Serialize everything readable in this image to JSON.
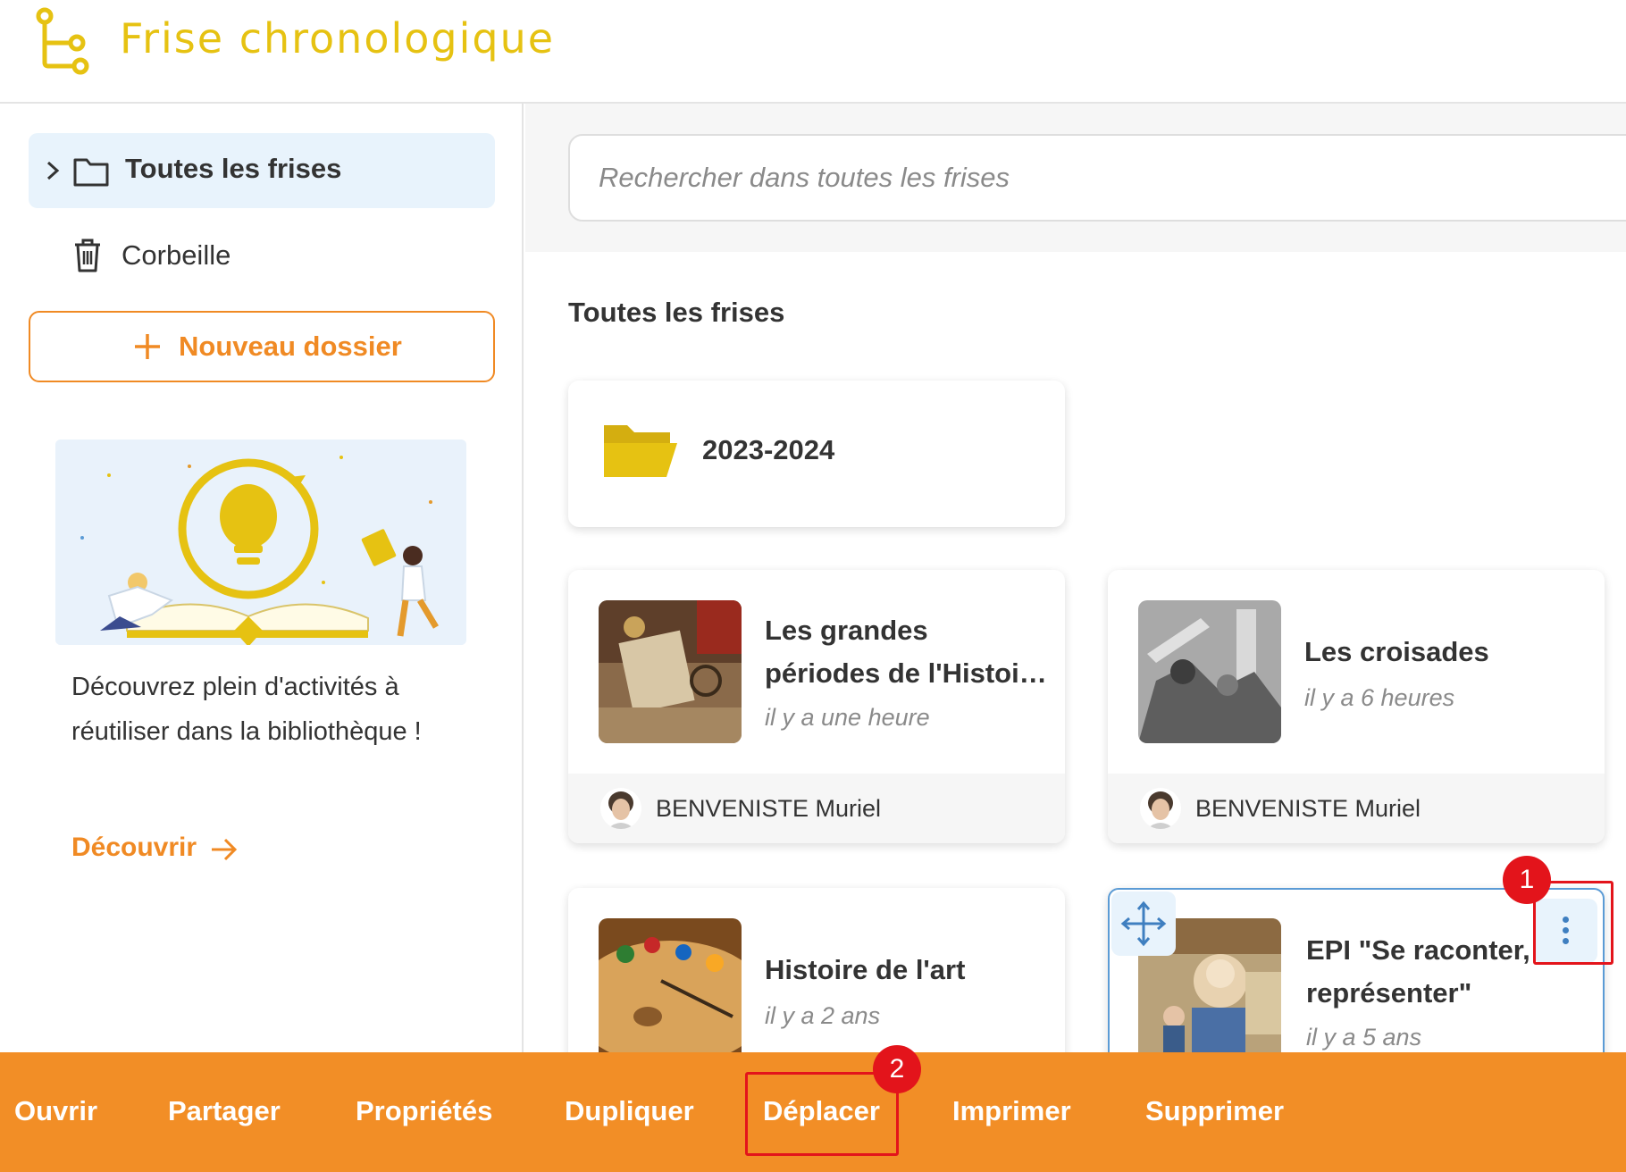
{
  "header": {
    "app_title": "Frise chronologique"
  },
  "sidebar": {
    "nav_all_label": "Toutes les frises",
    "nav_trash_label": "Corbeille",
    "new_folder_label": "Nouveau dossier",
    "promo_text": "Découvrez plein d'activités à réutiliser dans la bibliothèque !",
    "promo_link": "Découvrir"
  },
  "main": {
    "search_placeholder": "Rechercher dans toutes les frises",
    "section_title": "Toutes les frises",
    "folders": [
      {
        "name": "2023-2024"
      }
    ],
    "frises": [
      {
        "title": "Les grandes périodes de l'Histoi…",
        "date": "il y a une heure",
        "author": "BENVENISTE Muriel"
      },
      {
        "title": "Les croisades",
        "date": "il y a 6 heures",
        "author": "BENVENISTE Muriel"
      },
      {
        "title": "Histoire de l'art",
        "date": "il y a 2 ans"
      },
      {
        "title": "EPI \"Se raconter, se représenter\"",
        "date": "il y a 5 ans"
      }
    ]
  },
  "action_bar": {
    "actions": [
      "Ouvrir",
      "Partager",
      "Propriétés",
      "Dupliquer",
      "Déplacer",
      "Imprimer",
      "Supprimer"
    ]
  },
  "annotations": [
    {
      "label": "1"
    },
    {
      "label": "2"
    }
  ],
  "colors": {
    "brand_yellow": "#e6c212",
    "accent_orange": "#f08a24",
    "action_bar": "#f28e26",
    "selection_blue": "#5b9bd5",
    "highlight_red": "#e3141b"
  },
  "icons": [
    "logo-icon",
    "chevron-right-icon",
    "folder-outline-icon",
    "trash-icon",
    "plus-icon",
    "arrow-right-icon",
    "folder-open-icon",
    "move-icon",
    "more-vertical-icon"
  ]
}
